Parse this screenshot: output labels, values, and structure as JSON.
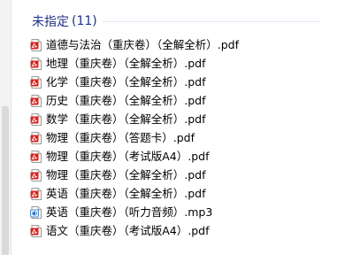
{
  "group": {
    "title": "未指定",
    "count": "(11)"
  },
  "files": [
    {
      "name": "道德与法治（重庆卷）（全解全析）.pdf",
      "icon": "pdf-icon"
    },
    {
      "name": "地理（重庆卷）（全解全析）.pdf",
      "icon": "pdf-icon"
    },
    {
      "name": "化学（重庆卷）（全解全析）.pdf",
      "icon": "pdf-icon"
    },
    {
      "name": "历史（重庆卷）（全解全析）.pdf",
      "icon": "pdf-icon"
    },
    {
      "name": "数学（重庆卷）（全解全析）.pdf",
      "icon": "pdf-icon"
    },
    {
      "name": "物理（重庆卷）（答题卡）.pdf",
      "icon": "pdf-icon"
    },
    {
      "name": "物理（重庆卷）（考试版A4）.pdf",
      "icon": "pdf-icon"
    },
    {
      "name": "物理（重庆卷）（全解全析）.pdf",
      "icon": "pdf-icon"
    },
    {
      "name": "英语（重庆卷）（全解全析）.pdf",
      "icon": "pdf-icon"
    },
    {
      "name": "英语（重庆卷）（听力音频）.mp3",
      "icon": "audio-file-icon"
    },
    {
      "name": "语文（重庆卷）（考试版A4）.pdf",
      "icon": "pdf-icon"
    }
  ],
  "colors": {
    "header": "#1e3287",
    "pdf_icon": "#d7241c",
    "audio_icon": "#2b6fc4"
  }
}
